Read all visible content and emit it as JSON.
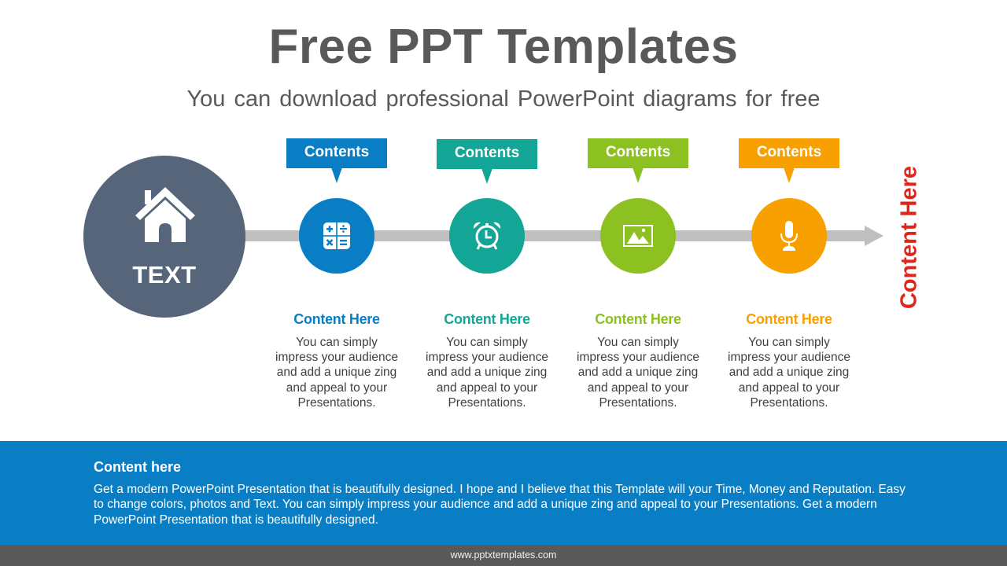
{
  "header": {
    "title": "Free PPT Templates",
    "subtitle": "You can download  professional PowerPoint  diagrams for free"
  },
  "hub": {
    "icon": "house-icon",
    "label": "TEXT",
    "color": "#56657a"
  },
  "timeline": {
    "track_color": "#bfbfbf",
    "end_arrow": "arrow-right-icon",
    "side_label": "Content Here",
    "side_label_color": "#e0251b"
  },
  "steps": [
    {
      "tag": "Contents",
      "icon": "calculator-icon",
      "color": "#0a7ec4",
      "title": "Content Here",
      "body": "You can simply impress your audience and add a unique zing and appeal to your Presentations."
    },
    {
      "tag": "Contents",
      "icon": "alarm-clock-icon",
      "color": "#13a596",
      "title": "Content Here",
      "body": "You can simply impress your audience and add a unique zing and appeal to your Presentations."
    },
    {
      "tag": "Contents",
      "icon": "image-icon",
      "color": "#8dc021",
      "title": "Content Here",
      "body": "You can simply impress your audience and add a unique zing and appeal to your Presentations."
    },
    {
      "tag": "Contents",
      "icon": "microphone-icon",
      "color": "#f7a000",
      "title": "Content Here",
      "body": "You can simply impress your audience and add a unique zing and appeal to your Presentations."
    }
  ],
  "footer": {
    "heading": "Content here",
    "body": "Get a modern PowerPoint  Presentation that is beautifully  designed. I hope and I believe that this Template  will your  Time, Money  and Reputation. Easy to change colors, photos and Text.  You  can simply impress your audience and add a unique zing and appeal to your  Presentations.  Get a modern PowerPoint  Presentation that is beautifully  designed.",
    "band_color": "#0a7ec4"
  },
  "bottom_bar": {
    "website": "www.pptxtemplates.com"
  }
}
